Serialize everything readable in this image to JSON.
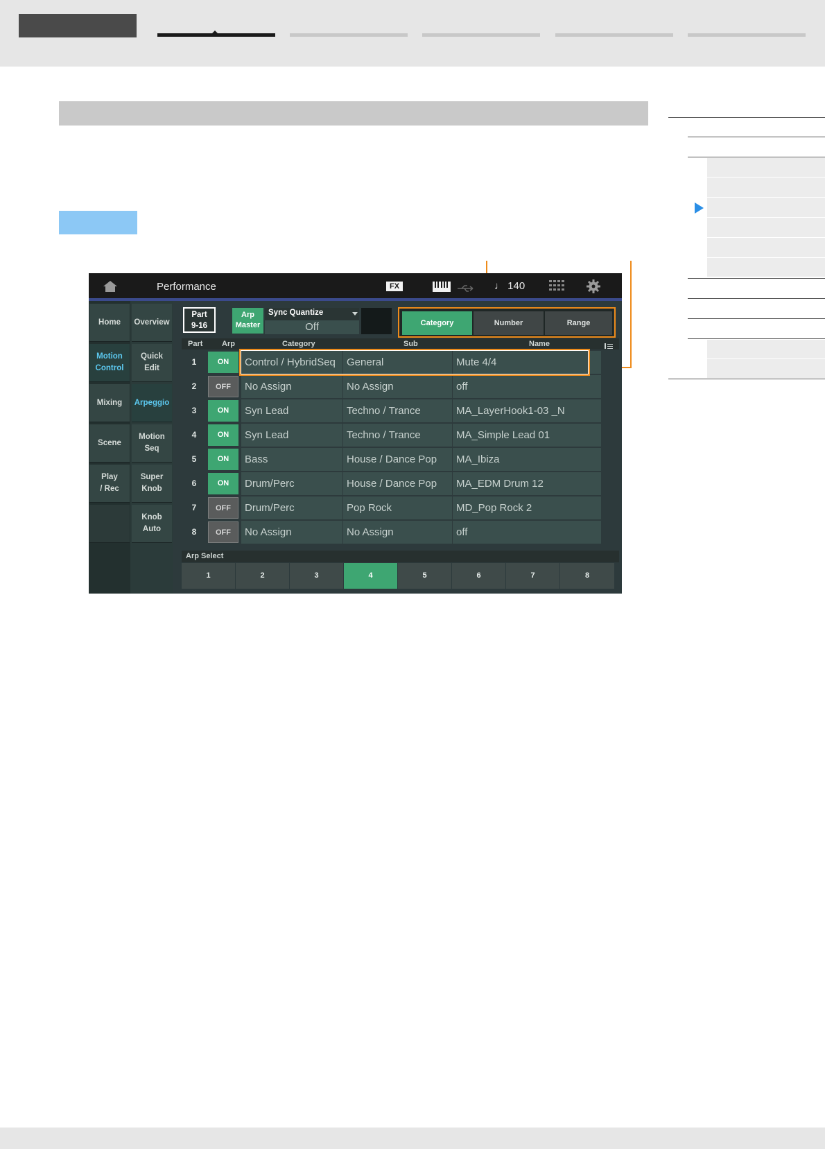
{
  "screen": {
    "topbar": {
      "title": "Performance",
      "fx_badge": "FX",
      "tempo": "♩ 140",
      "icons": [
        "home-icon",
        "keyboard-icon",
        "usb-icon",
        "grid-icon",
        "gear-icon"
      ]
    },
    "nav_col1": [
      {
        "label": "Home",
        "active": false
      },
      {
        "label": "Motion\nControl",
        "active": true
      },
      {
        "label": "Mixing",
        "active": false
      },
      {
        "label": "Scene",
        "active": false
      },
      {
        "label": "Play\n/ Rec",
        "active": false
      },
      {
        "label": "",
        "active": false
      }
    ],
    "nav_col2": [
      {
        "label": "Overview",
        "active": false
      },
      {
        "label": "Quick\nEdit",
        "active": false
      },
      {
        "label": "Arpeggio",
        "active": true
      },
      {
        "label": "Motion\nSeq",
        "active": false
      },
      {
        "label": "Super\nKnob",
        "active": false
      },
      {
        "label": "Knob\nAuto",
        "active": false
      }
    ],
    "controls": {
      "part_button": "Part\n9-16",
      "arp_master": "Arp\nMaster",
      "sync_quantize_label": "Sync Quantize",
      "sync_quantize_value": "Off",
      "view_tabs": [
        "Category",
        "Number",
        "Range"
      ],
      "active_tab": "Category"
    },
    "table": {
      "headers": {
        "part": "Part",
        "arp": "Arp",
        "category": "Category",
        "sub": "Sub",
        "name": "Name"
      },
      "rows": [
        {
          "part": "1",
          "arp": "ON",
          "category": "Control / HybridSeq",
          "sub": "General",
          "name": "Mute 4/4"
        },
        {
          "part": "2",
          "arp": "OFF",
          "category": "No Assign",
          "sub": "No Assign",
          "name": "off"
        },
        {
          "part": "3",
          "arp": "ON",
          "category": "Syn Lead",
          "sub": "Techno / Trance",
          "name": "MA_LayerHook1-03 _N"
        },
        {
          "part": "4",
          "arp": "ON",
          "category": "Syn Lead",
          "sub": "Techno / Trance",
          "name": "MA_Simple Lead 01"
        },
        {
          "part": "5",
          "arp": "ON",
          "category": "Bass",
          "sub": "House / Dance Pop",
          "name": "MA_Ibiza"
        },
        {
          "part": "6",
          "arp": "ON",
          "category": "Drum/Perc",
          "sub": "House / Dance Pop",
          "name": "MA_EDM Drum 12"
        },
        {
          "part": "7",
          "arp": "OFF",
          "category": "Drum/Perc",
          "sub": "Pop Rock",
          "name": "MD_Pop Rock 2"
        },
        {
          "part": "8",
          "arp": "OFF",
          "category": "No Assign",
          "sub": "No Assign",
          "name": "off"
        }
      ]
    },
    "arp_select": {
      "label": "Arp Select",
      "buttons": [
        "1",
        "2",
        "3",
        "4",
        "5",
        "6",
        "7",
        "8"
      ],
      "selected": "4"
    }
  },
  "colors": {
    "accent_green": "#3ea672",
    "callout_orange": "#ee8b1a",
    "active_blue": "#5cc8ef",
    "toc_arrow": "#2a8ee6"
  }
}
